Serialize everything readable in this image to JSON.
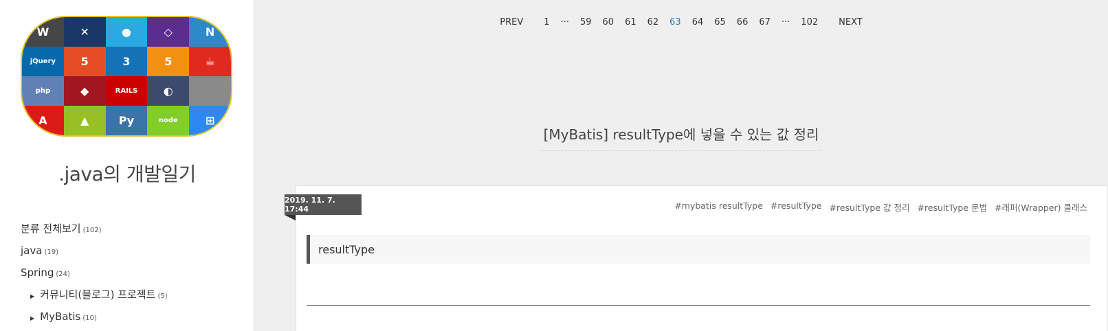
{
  "sidebar": {
    "blog_title": ".java의 개발일기",
    "logo_tiles": [
      {
        "icon": "wordpress-icon",
        "glyph": "W",
        "color": "#464646"
      },
      {
        "icon": "joomla-icon",
        "glyph": "✕",
        "color": "#1a3867"
      },
      {
        "icon": "drupal-icon",
        "glyph": "●",
        "color": "#2ba9e0"
      },
      {
        "icon": "framework-icon",
        "glyph": "◇",
        "color": "#5c2d91"
      },
      {
        "icon": "dotnet-icon",
        "glyph": "N",
        "color": "#2e89c9"
      },
      {
        "icon": "jquery-icon",
        "glyph": "jQuery",
        "color": "#0868ac"
      },
      {
        "icon": "html5-icon",
        "glyph": "5",
        "color": "#e44d26"
      },
      {
        "icon": "css3-icon",
        "glyph": "3",
        "color": "#1572b6"
      },
      {
        "icon": "html5-orange-icon",
        "glyph": "5",
        "color": "#f29111"
      },
      {
        "icon": "java-icon",
        "glyph": "☕",
        "color": "#e02a20"
      },
      {
        "icon": "php-icon",
        "glyph": "php",
        "color": "#6181b6"
      },
      {
        "icon": "ruby-icon",
        "glyph": "◆",
        "color": "#a11620"
      },
      {
        "icon": "rails-icon",
        "glyph": "RAILS",
        "color": "#cc0000"
      },
      {
        "icon": "onion-icon",
        "glyph": "◐",
        "color": "#3e4a6b"
      },
      {
        "icon": "apple-icon",
        "glyph": "",
        "color": "#8a8a8a"
      },
      {
        "icon": "angular-icon",
        "glyph": "A",
        "color": "#dd1b16"
      },
      {
        "icon": "android-icon",
        "glyph": "▲",
        "color": "#97c024"
      },
      {
        "icon": "python-icon",
        "glyph": "Py",
        "color": "#3a74a8"
      },
      {
        "icon": "node-icon",
        "glyph": "node",
        "color": "#83cd29"
      },
      {
        "icon": "windows-icon",
        "glyph": "⊞",
        "color": "#2d89ef"
      }
    ],
    "categories": [
      {
        "label": "분류 전체보기",
        "count": "(102)",
        "sub": false
      },
      {
        "label": "java",
        "count": "(19)",
        "sub": false
      },
      {
        "label": "Spring",
        "count": "(24)",
        "sub": false
      },
      {
        "label": "커뮤니티(블로그) 프로젝트",
        "count": "(5)",
        "sub": true
      },
      {
        "label": "MyBatis",
        "count": "(10)",
        "sub": true
      }
    ]
  },
  "pager": {
    "prev": "PREV",
    "pages": [
      "1",
      "···",
      "59",
      "60",
      "61",
      "62",
      "63",
      "64",
      "65",
      "66",
      "67",
      "···",
      "102"
    ],
    "current": "63",
    "next": "NEXT"
  },
  "post": {
    "title": "[MyBatis] resultType에 넣을 수 있는 값 정리",
    "date": "2019. 11. 7. 17:44",
    "tags": [
      "#mybatis resultType",
      "#resultType",
      "#resultType 값 정리",
      "#resultType 문법",
      "#래퍼(Wrapper) 클래스"
    ],
    "section_heading": "resultType"
  },
  "colors": {
    "accent_link": "#2a7ab8",
    "date_tag": "#555555",
    "logo_border": "#e3c22a"
  }
}
